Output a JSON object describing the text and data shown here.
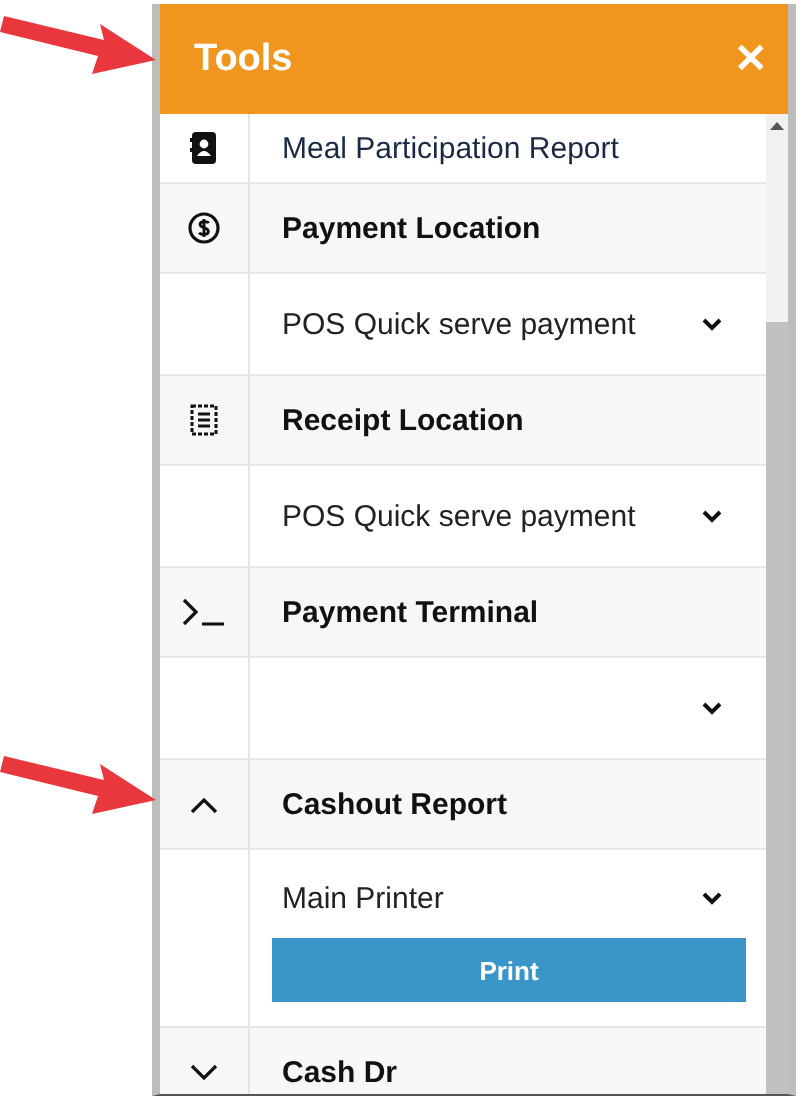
{
  "panel": {
    "title": "Tools",
    "close": "✕"
  },
  "items": [
    {
      "kind": "link",
      "label": "Meal Participation Report"
    },
    {
      "kind": "header",
      "label": "Payment Location"
    },
    {
      "kind": "select",
      "value": "POS Quick serve payment"
    },
    {
      "kind": "header",
      "label": "Receipt Location"
    },
    {
      "kind": "select",
      "value": "POS Quick serve payment"
    },
    {
      "kind": "header",
      "label": "Payment Terminal"
    },
    {
      "kind": "select"
    },
    {
      "kind": "header",
      "label": "Cashout Report"
    },
    {
      "kind": "select",
      "value": "Main Printer",
      "button": "Print"
    },
    {
      "kind": "header",
      "label": "Cash Dr"
    }
  ]
}
